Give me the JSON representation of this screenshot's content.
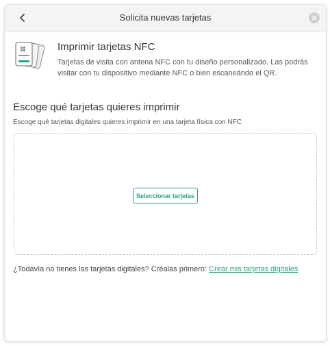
{
  "header": {
    "title": "Solicita nuevas tarjetas",
    "back_icon": "chevron-left-icon",
    "close_icon": "close-icon"
  },
  "intro": {
    "title": "Imprimir tarjetas NFC",
    "description": "Tarjetas de visita con antena NFC con tu diseño personalizado. Las podrás visitar con tu dispositivo mediante NFC o bien escaneándo el QR.",
    "icon": "nfc-cards-icon"
  },
  "choose": {
    "title": "Escoge qué tarjetas quieres imprimir",
    "description": "Escoge qué tarjetas digitales quieres imprimir en una tarjeta física con NFC",
    "button_label": "Seleccionar tarjetas"
  },
  "footer": {
    "text": "¿Todavía no tienes las tarjetas digitales? Créalas primero:",
    "link_label": "Crear mis tarjetas digitales"
  },
  "colors": {
    "accent": "#2aa37a",
    "header_bg": "#f4f4f4"
  }
}
